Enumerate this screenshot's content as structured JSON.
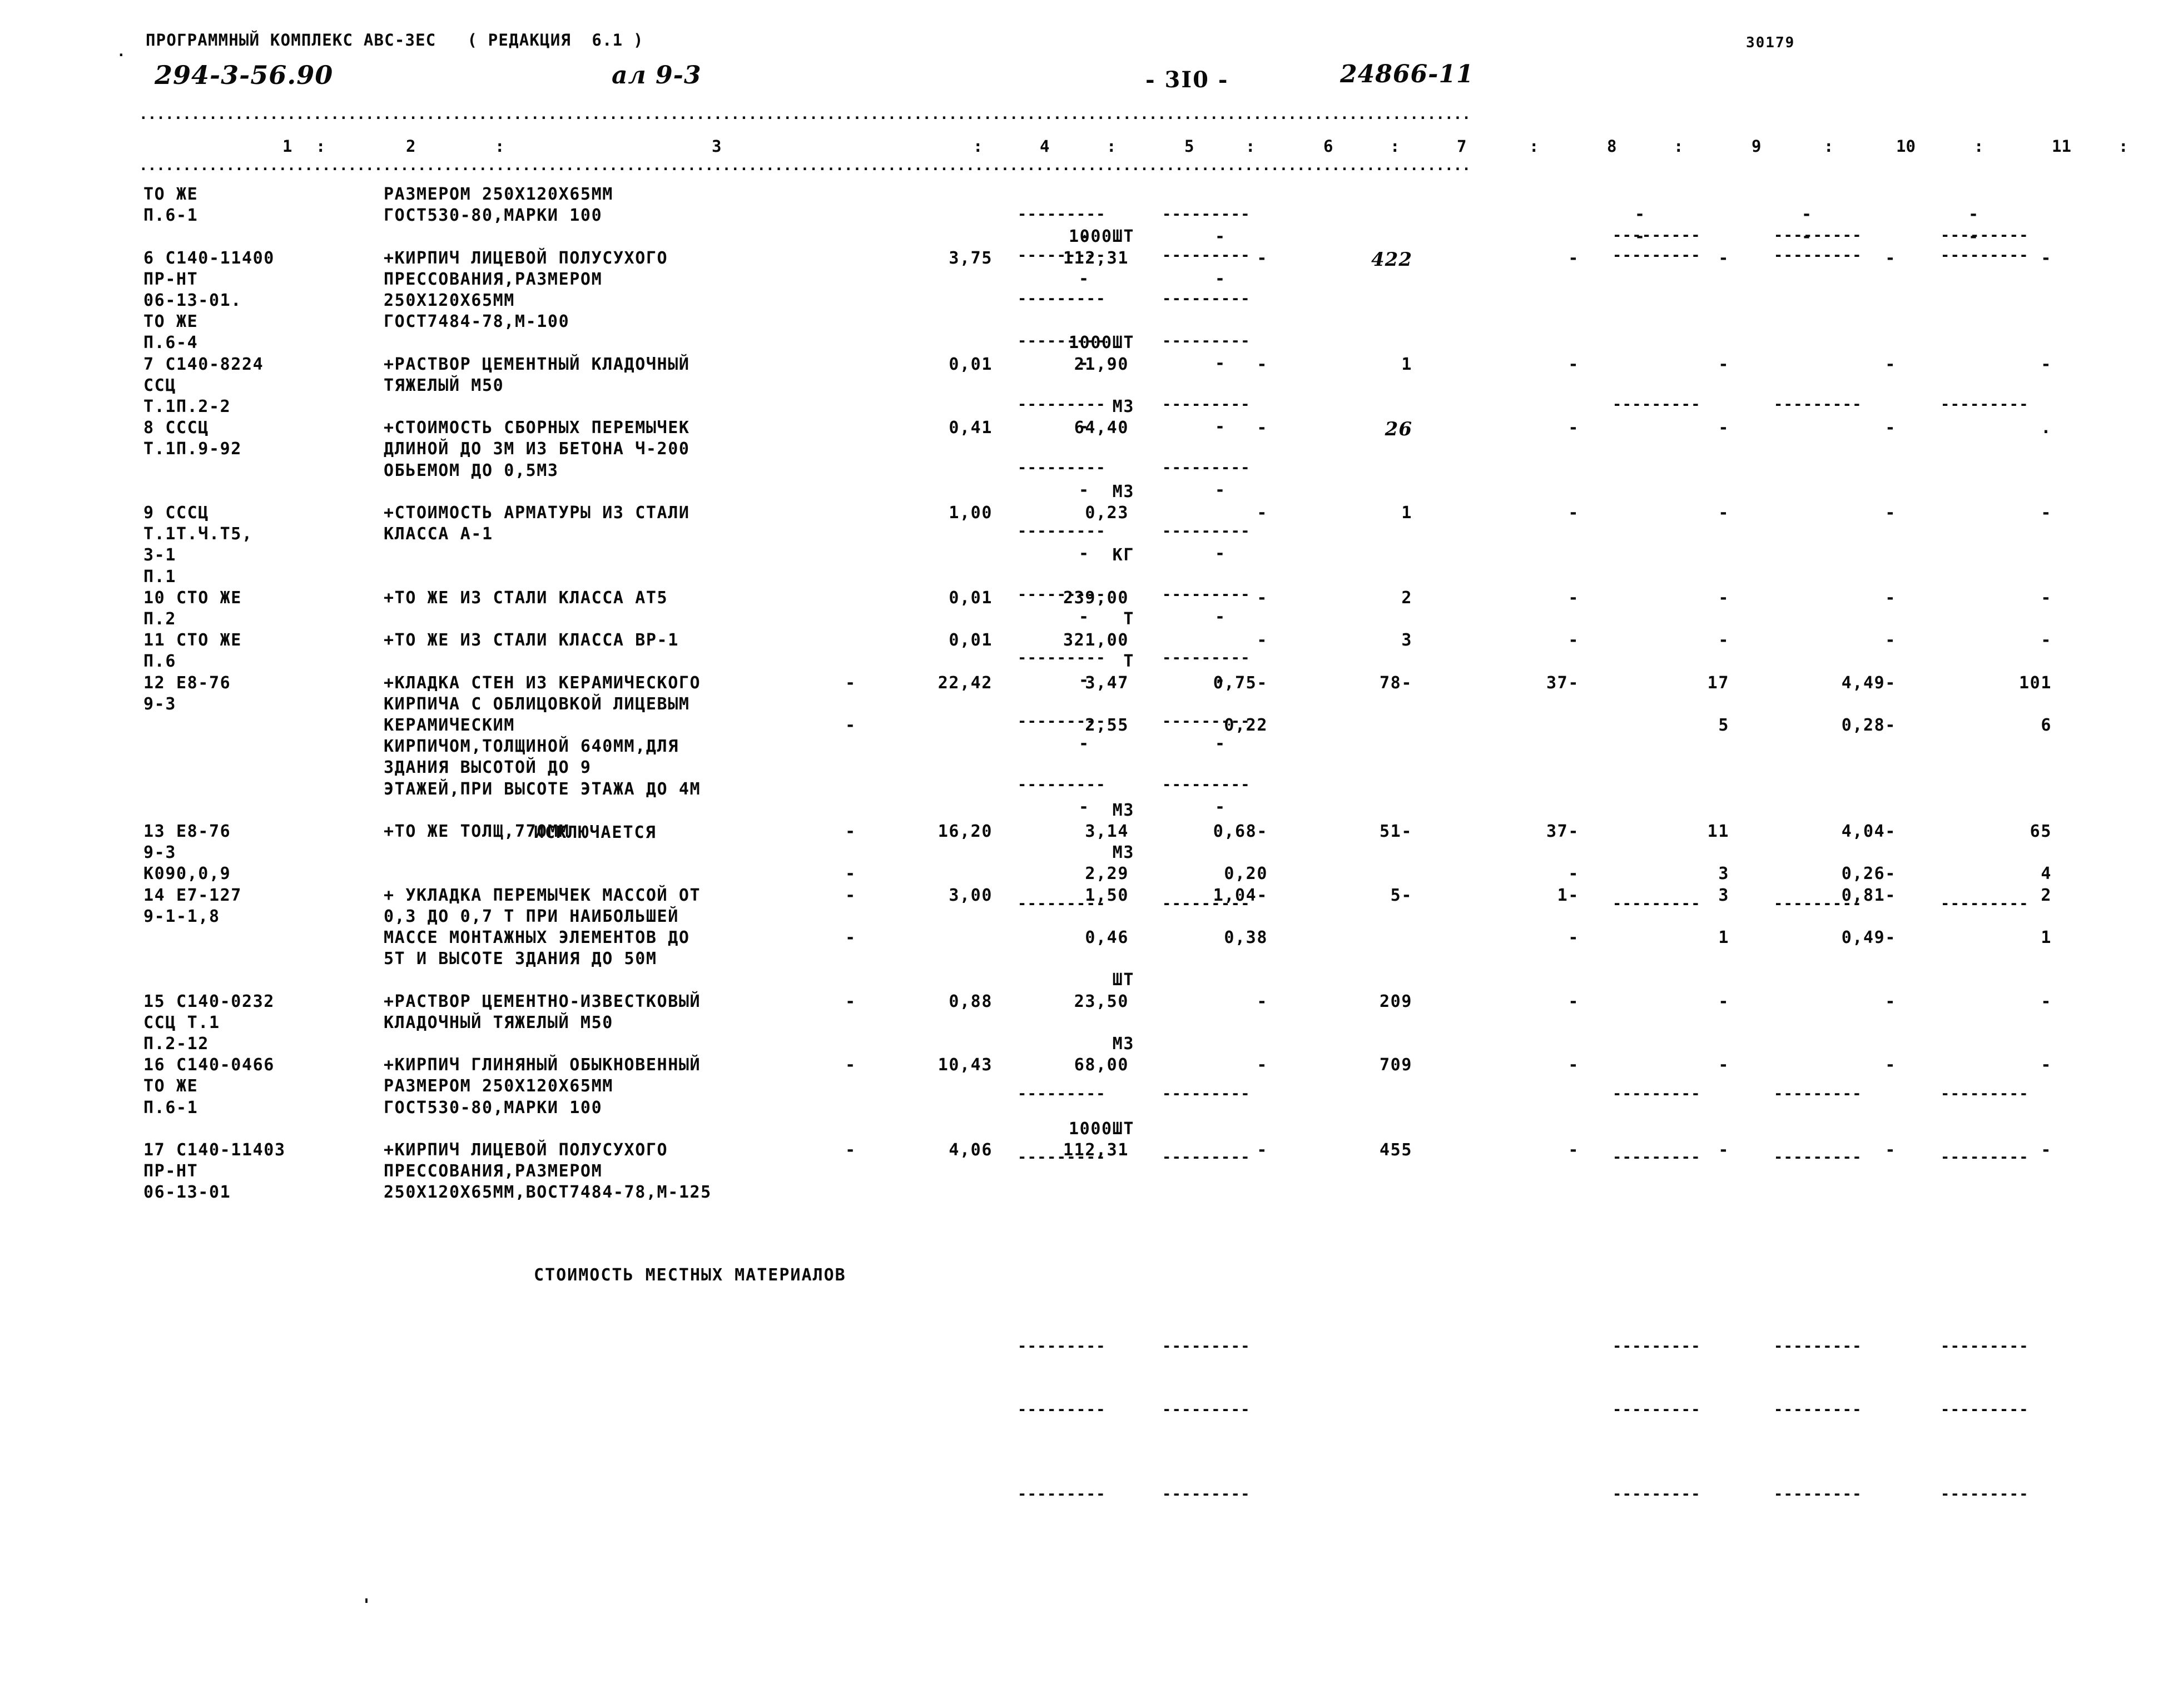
{
  "header": {
    "system_line": "ПРОГРАММНЫЙ КОМПЛЕКС АВС-3ЕС   ( РЕДАКЦИЯ  6.1 )",
    "leading_dot": ".",
    "project_code": "294-3-56.90",
    "sheet_label": "ал 9-3",
    "page_number": "- 3I0 -",
    "doc_number": "24866-11",
    "right_code": "30179"
  },
  "column_headers": [
    "1",
    "2",
    "3",
    "4",
    "5",
    "6",
    "7",
    "8",
    "9",
    "10",
    "11"
  ],
  "separator_text": ".........................................................................................................................................................",
  "short_dashes": "---------",
  "sections": {
    "excluded": "ИСКЛЮЧАЕТСЯ",
    "local_materials": "СТОИМОСТЬ МЕСТНЫХ МАТЕРИАЛОВ"
  },
  "rows": [
    {
      "code": "ТО ЖЕ",
      "desc": "РАЗМЕРОМ 250Х120Х65ММ"
    },
    {
      "code": "П.6-1",
      "desc": "ГОСТ530-80,МАРКИ 100"
    },
    {
      "unit": "1000ШТ"
    },
    {
      "code": "6 С140-11400",
      "desc": "+КИРПИЧ ЛИЦЕВОЙ ПОЛУСУХОГО",
      "c4": "3,75",
      "c5": "112,31",
      "c6": "-",
      "c7": "422",
      "c8": "-",
      "c9": "-",
      "c10": "-",
      "c11": "-"
    },
    {
      "code": "ПР-НТ",
      "desc": "ПРЕССОВАНИЯ,РАЗМЕРОМ"
    },
    {
      "code": "06-13-01.",
      "desc": "250Х120Х65ММ"
    },
    {
      "code": "ТО ЖЕ",
      "desc": "ГОСТ7484-78,М-100"
    },
    {
      "code": "П.6-4",
      "unit": "1000ШТ"
    },
    {
      "code": "7 С140-8224",
      "desc": "+РАСТВОР ЦЕМЕНТНЫЙ КЛАДОЧНЫЙ",
      "c4": "0,01",
      "c5": "21,90",
      "c6": "-",
      "c7": "1",
      "c8": "-",
      "c9": "-",
      "c10": "-",
      "c11": "-"
    },
    {
      "code": "ССЦ",
      "desc": "ТЯЖЕЛЫЙ М50"
    },
    {
      "code": "Т.1П.2-2",
      "unit": "М3"
    },
    {
      "code": "8 СССЦ",
      "desc": "+СТОИМОСТЬ СБОРНЫХ ПЕРЕМЫЧЕК",
      "c4": "0,41",
      "c5": "64,40",
      "c6": "-",
      "c7": "26",
      "c8": "-",
      "c9": "-",
      "c10": "-",
      "c11": "."
    },
    {
      "code": "Т.1П.9-92",
      "desc": "ДЛИНОЙ ДО 3М ИЗ БЕТОНА Ч-200"
    },
    {
      "desc": "ОБЬЕМОМ ДО 0,5М3"
    },
    {
      "unit": "М3"
    },
    {
      "code": "9 СССЦ",
      "desc": "+СТОИМОСТЬ АРМАТУРЫ ИЗ СТАЛИ",
      "c4": "1,00",
      "c5": "0,23",
      "c6": "-",
      "c7": "1",
      "c8": "-",
      "c9": "-",
      "c10": "-",
      "c11": "-"
    },
    {
      "code": "Т.1Т.Ч.Т5,",
      "desc": "КЛАССА А-1"
    },
    {
      "code": "3-1",
      "unit": "КГ"
    },
    {
      "code": "П.1"
    },
    {
      "code": "10 СТО ЖЕ",
      "desc": "+ТО ЖЕ ИЗ СТАЛИ КЛАССА АТ5",
      "c4": "0,01",
      "c5": "239,00",
      "c6": "-",
      "c7": "2",
      "c8": "-",
      "c9": "-",
      "c10": "-",
      "c11": "-"
    },
    {
      "code": "П.2",
      "unit": "Т"
    },
    {
      "code": "11 СТО ЖЕ",
      "desc": "+ТО ЖЕ ИЗ СТАЛИ КЛАССА ВР-1",
      "c4": "0,01",
      "c5": "321,00",
      "c6": "-",
      "c7": "3",
      "c8": "-",
      "c9": "-",
      "c10": "-",
      "c11": "-"
    },
    {
      "code": "П.6",
      "unit": "Т"
    },
    {
      "code": "12 Е8-76",
      "desc": "+КЛАДКА СТЕН ИЗ КЕРАМИЧЕСКОГО",
      "dash": "-",
      "c4": "22,42",
      "c5": "3,47",
      "c6": "0,75-",
      "c7": "78-",
      "c8": "37-",
      "c9": "17",
      "c10": "4,49-",
      "c11": "101"
    },
    {
      "code": "9-3",
      "desc": "КИРПИЧА С ОБЛИЦОВКОЙ ЛИЦЕВЫМ"
    },
    {
      "desc": "КЕРАМИЧЕСКИМ",
      "dash": "-",
      "c5": "2,55",
      "c6": "0,22",
      "c9": "5",
      "c10": "0,28-",
      "c11": "6"
    },
    {
      "desc": "КИРПИЧОМ,ТОЛЩИНОЙ 640ММ,ДЛЯ"
    },
    {
      "desc": "ЗДАНИЯ ВЫСОТОЙ ДО 9"
    },
    {
      "desc": "ЭТАЖЕЙ,ПРИ ВЫСОТЕ ЭТАЖА ДО 4М"
    },
    {
      "unit": "М3"
    },
    {
      "code": "13 Е8-76",
      "desc": "+ТО ЖЕ ТОЛЩ,770ММ",
      "dash": "-",
      "c4": "16,20",
      "c5": "3,14",
      "c6": "0,68-",
      "c7": "51-",
      "c8": "37-",
      "c9": "11",
      "c10": "4,04-",
      "c11": "65"
    },
    {
      "code": "9-3",
      "unit": "М3"
    },
    {
      "code": "К090,0,9",
      "dash": "-",
      "c5": "2,29",
      "c6": "0,20",
      "c8": "-",
      "c9": "3",
      "c10": "0,26-",
      "c11": "4"
    },
    {
      "code": "14 Е7-127",
      "desc": "+ УКЛАДКА ПЕРЕМЫЧЕК МАССОЙ ОТ",
      "dash": "-",
      "c4": "3,00",
      "c5": "1,50",
      "c6": "1,04-",
      "c7": "5-",
      "c8": "1-",
      "c9": "3",
      "c10": "0,81-",
      "c11": "2"
    },
    {
      "code": "9-1-1,8",
      "desc": "0,3 ДО 0,7 Т ПРИ НАИБОЛЬШЕЙ"
    },
    {
      "desc": "МАССЕ МОНТАЖНЫХ ЭЛЕМЕНТОВ ДО",
      "dash": "-",
      "c5": "0,46",
      "c6": "0,38",
      "c8": "-",
      "c9": "1",
      "c10": "0,49-",
      "c11": "1"
    },
    {
      "desc": "5Т И ВЫСОТЕ ЗДАНИЯ ДО 50М"
    },
    {
      "unit": "ШТ"
    },
    {
      "code": "15 С140-0232",
      "desc": "+РАСТВОР ЦЕМЕНТНО-ИЗВЕСТКОВЫЙ",
      "dash": "-",
      "c4": "0,88",
      "c5": "23,50",
      "c6": "-",
      "c7": "209",
      "c8": "-",
      "c9": "-",
      "c10": "-",
      "c11": "-"
    },
    {
      "code": "ССЦ Т.1",
      "desc": "КЛАДОЧНЫЙ ТЯЖЕЛЫЙ М50"
    },
    {
      "code": "П.2-12",
      "unit": "М3"
    },
    {
      "code": "16 С140-0466",
      "desc": "+КИРПИЧ ГЛИНЯНЫЙ ОБЫКНОВЕННЫЙ",
      "dash": "-",
      "c4": "10,43",
      "c5": "68,00",
      "c6": "-",
      "c7": "709",
      "c8": "-",
      "c9": "-",
      "c10": "-",
      "c11": "-"
    },
    {
      "code": "ТО ЖЕ",
      "desc": "РАЗМЕРОМ 250Х120Х65ММ"
    },
    {
      "code": "П.6-1",
      "desc": "ГОСТ530-80,МАРКИ 100"
    },
    {
      "unit": "1000ШТ"
    },
    {
      "code": "17 С140-11403",
      "desc": "+КИРПИЧ ЛИЦЕВОЙ ПОЛУСУХОГО",
      "dash": "-",
      "c4": "4,06",
      "c5": "112,31",
      "c6": "-",
      "c7": "455",
      "c8": "-",
      "c9": "-",
      "c10": "-",
      "c11": "-"
    },
    {
      "code": "ПР-НТ",
      "desc": "ПРЕССОВАНИЯ,РАЗМЕРОМ"
    },
    {
      "code": "06-13-01",
      "desc": "250Х120Х65ММ,ВОСТ7484-78,М-125"
    }
  ]
}
